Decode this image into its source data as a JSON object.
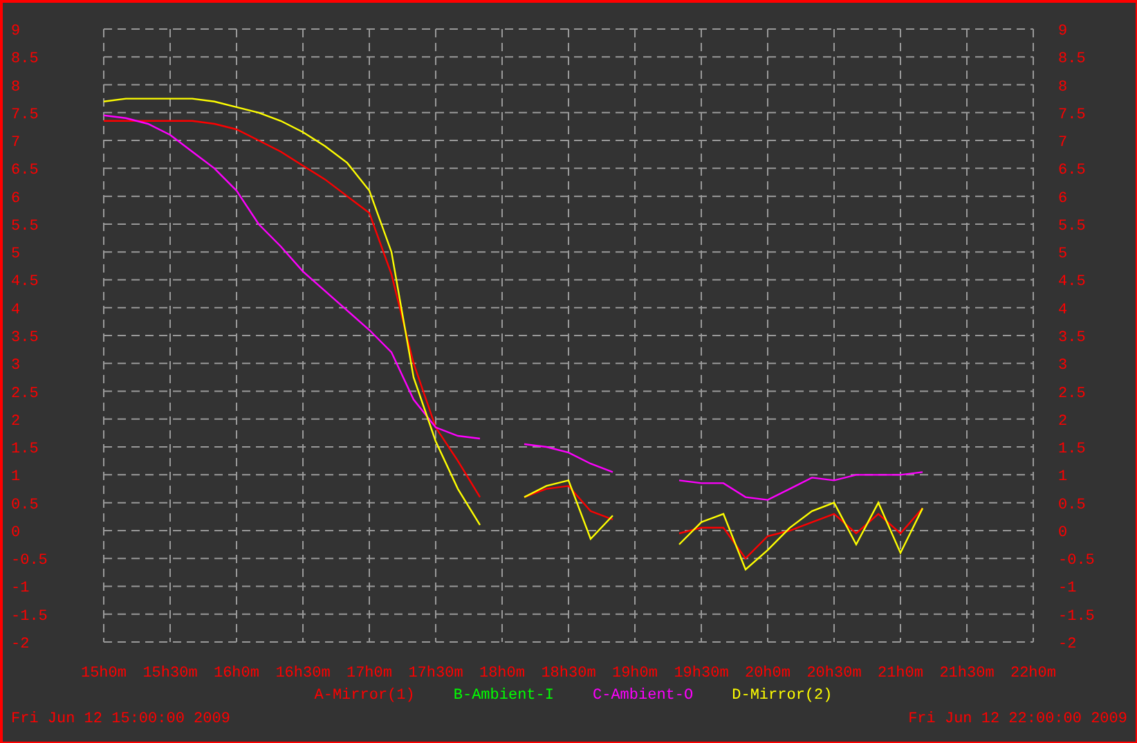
{
  "chart_data": {
    "type": "line",
    "grid": true,
    "ylim": [
      -2,
      9
    ],
    "categories": [
      "15h0m",
      null,
      null,
      "15h30m",
      null,
      null,
      "16h0m",
      null,
      null,
      "16h30m",
      null,
      null,
      "17h0m",
      null,
      null,
      "17h30m",
      null,
      null,
      "18h0m",
      null,
      null,
      "18h30m",
      null,
      null,
      "19h0m",
      null,
      null,
      "19h30m",
      null,
      null,
      "20h0m",
      null,
      null,
      "20h30m",
      null,
      null,
      "21h0m",
      null,
      null,
      "21h30m",
      null,
      null,
      "22h0m"
    ],
    "yticks": [
      -2,
      -1.5,
      -1,
      -0.5,
      0,
      0.5,
      1,
      1.5,
      2,
      2.5,
      3,
      3.5,
      4,
      4.5,
      5,
      5.5,
      6,
      6.5,
      7,
      7.5,
      8,
      8.5,
      9
    ],
    "series": [
      {
        "name": "A-Mirror(1)",
        "color": "#ff0000",
        "values": [
          7.35,
          7.35,
          7.35,
          7.35,
          7.35,
          7.3,
          7.2,
          7.0,
          6.8,
          6.55,
          6.3,
          6.0,
          5.7,
          4.6,
          3.0,
          1.85,
          1.25,
          0.6,
          null,
          0.6,
          0.75,
          0.8,
          0.35,
          0.2,
          null,
          null,
          -0.05,
          0.05,
          0.05,
          -0.5,
          -0.1,
          0.0,
          0.15,
          0.3,
          -0.05,
          0.3,
          -0.05,
          0.4,
          null,
          null,
          null,
          null,
          null
        ]
      },
      {
        "name": "B-Ambient-I",
        "color": "#00ff00",
        "values": [
          null,
          null,
          null,
          null,
          null,
          null,
          null,
          null,
          null,
          null,
          null,
          null,
          null,
          null,
          null,
          null,
          null,
          null,
          null,
          null,
          null,
          null,
          null,
          null,
          null,
          null,
          null,
          null,
          null,
          null,
          null,
          null,
          null,
          null,
          null,
          null,
          null,
          null,
          null,
          null,
          null,
          null,
          null
        ]
      },
      {
        "name": "C-Ambient-O",
        "color": "#ff00ff",
        "values": [
          7.45,
          7.4,
          7.3,
          7.1,
          6.8,
          6.5,
          6.1,
          5.5,
          5.1,
          4.65,
          4.3,
          3.95,
          3.6,
          3.2,
          2.35,
          1.85,
          1.7,
          1.65,
          null,
          1.55,
          1.5,
          1.4,
          1.2,
          1.05,
          null,
          null,
          0.9,
          0.85,
          0.85,
          0.6,
          0.55,
          0.75,
          0.95,
          0.9,
          1.0,
          1.0,
          1.0,
          1.05,
          null,
          null,
          null,
          null,
          null
        ]
      },
      {
        "name": "D-Mirror(2)",
        "color": "#ffff00",
        "values": [
          7.7,
          7.75,
          7.75,
          7.75,
          7.75,
          7.7,
          7.6,
          7.5,
          7.35,
          7.15,
          6.9,
          6.6,
          6.1,
          5.0,
          2.75,
          1.6,
          0.75,
          0.1,
          null,
          0.6,
          0.8,
          0.9,
          -0.15,
          0.27,
          null,
          null,
          -0.25,
          0.15,
          0.3,
          -0.7,
          -0.35,
          0.05,
          0.35,
          0.5,
          -0.25,
          0.5,
          -0.4,
          0.4,
          null,
          null,
          null,
          null,
          null
        ]
      }
    ]
  },
  "left_axis": {
    "labels": [
      "9",
      "8.5",
      "8",
      "7.5",
      "7",
      "6.5",
      "6",
      "5.5",
      "5",
      "4.5",
      "4",
      "3.5",
      "3",
      "2.5",
      "2",
      "1.5",
      "1",
      "0.5",
      "0",
      "-0.5",
      "-1",
      "-1.5",
      "-2"
    ]
  },
  "footer": {
    "start": "Fri Jun 12 15:00:00 2009",
    "end": "Fri Jun 12 22:00:00 2009"
  }
}
